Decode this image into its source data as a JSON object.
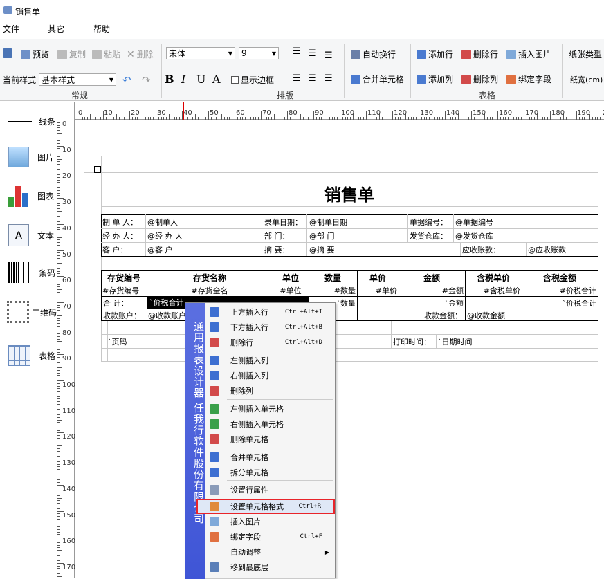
{
  "app": {
    "title": "销售单"
  },
  "menubar": [
    "文件",
    "其它",
    "帮助"
  ],
  "toolbar": {
    "save": "",
    "preview": "预览",
    "copy": "复制",
    "paste": "粘贴",
    "delete": "删除",
    "font": "宋体",
    "font_size": "9",
    "auto_wrap": "自动换行",
    "merge_cells": "合并单元格",
    "add_row": "添加行",
    "delete_row": "删除行",
    "insert_image": "插入图片",
    "add_col": "添加列",
    "delete_col": "删除列",
    "bind_field": "绑定字段",
    "paper_type": "纸张类型",
    "paper_width": "纸宽(cm)",
    "current_style_label": "当前样式",
    "current_style": "基本样式",
    "bold": "B",
    "italic": "I",
    "underline": "U",
    "font_color": "A",
    "show_border": "显示边框"
  },
  "groups": {
    "general": "常规",
    "layout": "排版",
    "table": "表格"
  },
  "tools": [
    "线条",
    "图片",
    "图表",
    "文本",
    "条码",
    "二维码",
    "表格"
  ],
  "ruler": {
    "h": [
      "0",
      "10",
      "20",
      "30",
      "40",
      "50",
      "60",
      "70",
      "80",
      "90",
      "100",
      "110",
      "120",
      "130",
      "140",
      "150",
      "160",
      "170",
      "180",
      "190",
      "2"
    ],
    "v": [
      "0",
      "10",
      "20",
      "30",
      "40",
      "50",
      "60",
      "70",
      "80",
      "90",
      "100",
      "110",
      "120",
      "130",
      "140",
      "150",
      "160",
      "170"
    ]
  },
  "report": {
    "title": "销售单",
    "r1": [
      "制 单 人：",
      "@制单人",
      "录单日期：",
      "@制单日期",
      "单据编号：",
      "@单据编号"
    ],
    "r2": [
      "经 办 人：",
      "@经 办 人",
      "部    门：",
      "@部    门",
      "发货仓库：",
      "@发货仓库"
    ],
    "r3": [
      "客    户：",
      "@客    户",
      "摘    要：",
      "@摘    要",
      "应收账款：",
      "@应收账款"
    ],
    "headers": [
      "存货编号",
      "存货名称",
      "单位",
      "数量",
      "单价",
      "金额",
      "含税单价",
      "含税金额"
    ],
    "detail": [
      "#存货编号",
      "#存货全名",
      "#单位",
      "#数量",
      "#单价",
      "#金额",
      "#含税单价",
      "#价税合计"
    ],
    "total": [
      "合    计：",
      "`价税合计",
      "`数量",
      "`金额",
      "`价税合计"
    ],
    "pay": [
      "收款账户：",
      "@收款账户",
      "收款金额：",
      "@收款金额"
    ],
    "footer": [
      "`页码",
      "打印时间：",
      "`日期时间"
    ]
  },
  "context_menu": {
    "side_text": "通用报表设计器    任我行软件股份有限公司",
    "items": [
      {
        "label": "上方插入行",
        "shortcut": "Ctrl+Alt+I"
      },
      {
        "label": "下方插入行",
        "shortcut": "Ctrl+Alt+B"
      },
      {
        "label": "删除行",
        "shortcut": "Ctrl+Alt+D"
      },
      {
        "label": "左侧插入列",
        "shortcut": ""
      },
      {
        "label": "右侧插入列",
        "shortcut": ""
      },
      {
        "label": "删除列",
        "shortcut": ""
      },
      {
        "label": "左侧插入单元格",
        "shortcut": ""
      },
      {
        "label": "右侧插入单元格",
        "shortcut": ""
      },
      {
        "label": "删除单元格",
        "shortcut": ""
      },
      {
        "label": "合并单元格",
        "shortcut": ""
      },
      {
        "label": "拆分单元格",
        "shortcut": ""
      },
      {
        "label": "设置行属性",
        "shortcut": ""
      },
      {
        "label": "设置单元格格式",
        "shortcut": "Ctrl+R"
      },
      {
        "label": "插入图片",
        "shortcut": ""
      },
      {
        "label": "绑定字段",
        "shortcut": "Ctrl+F"
      },
      {
        "label": "自动调整",
        "shortcut": ""
      },
      {
        "label": "移到最底层",
        "shortcut": ""
      }
    ],
    "highlighted_index": 12,
    "highlight_color": "#e8242a"
  }
}
